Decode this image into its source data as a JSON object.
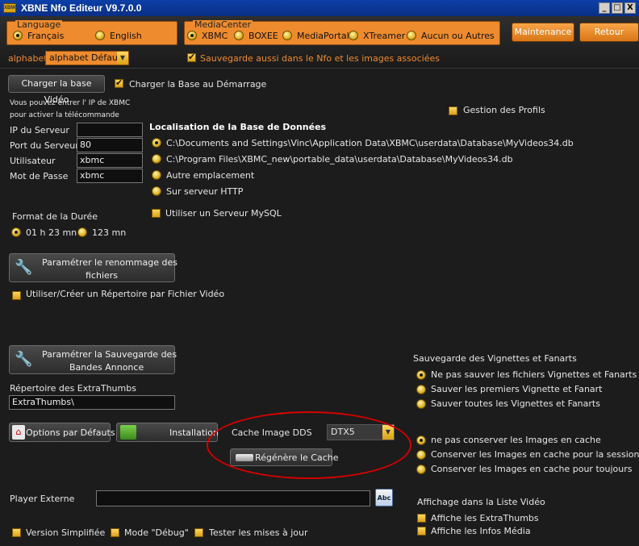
{
  "window": {
    "title": "XBNE Nfo Editeur V9.7.0.0",
    "app_icon_text": "XBMC",
    "min": "_",
    "max": "□",
    "close": "X"
  },
  "language": {
    "label": "Language",
    "options": [
      {
        "label": "Français",
        "selected": true
      },
      {
        "label": "English",
        "selected": false
      }
    ]
  },
  "mediacenter": {
    "label": "MediaCenter",
    "options": [
      {
        "label": "XBMC",
        "selected": true
      },
      {
        "label": "BOXEE",
        "selected": false
      },
      {
        "label": "MediaPortal",
        "selected": false
      },
      {
        "label": "XTreamer",
        "selected": false
      },
      {
        "label": "Aucun ou Autres",
        "selected": false
      }
    ]
  },
  "toolbar": {
    "maintenance": "Maintenance",
    "retour": "Retour"
  },
  "alphabet": {
    "label": "alphabet",
    "value": "alphabet Défaut"
  },
  "save_nfo": {
    "label": "Sauvegarde aussi dans le Nfo et les images associées",
    "checked": true
  },
  "db": {
    "load_button": "Charger la base Vidéo",
    "load_on_start": {
      "label": "Charger la Base au Démarrage",
      "checked": true
    },
    "remote_note_1": "Vous pouvez entrer l' IP de XBMC",
    "remote_note_2": "pour activer la télécommande",
    "profiles": "Gestion des Profils",
    "fields": {
      "ip_label": "IP du Serveur",
      "ip_value": "",
      "port_label": "Port du Serveur",
      "port_value": "80",
      "user_label": "Utilisateur",
      "user_value": "xbmc",
      "pass_label": "Mot de Passe",
      "pass_value": "xbmc"
    },
    "location_title": "Localisation de la Base de Données",
    "locations": [
      {
        "label": "C:\\Documents and Settings\\Vinc\\Application Data\\XBMC\\userdata\\Database\\MyVideos34.db",
        "selected": true
      },
      {
        "label": "C:\\Program Files\\XBMC_new\\portable_data\\userdata\\Database\\MyVideos34.db",
        "selected": false
      },
      {
        "label": "Autre emplacement",
        "selected": false
      },
      {
        "label": "Sur serveur HTTP",
        "selected": false
      }
    ],
    "mysql": "Utiliser un Serveur MySQL"
  },
  "duration": {
    "label": "Format de la Durée",
    "options": [
      {
        "label": "01 h 23 mn",
        "selected": true
      },
      {
        "label": "123 mn",
        "selected": false
      }
    ]
  },
  "rename": {
    "button_line1": "Paramétrer le renommage des",
    "button_line2": "fichiers",
    "per_file_dir": "Utiliser/Créer un Répertoire par Fichier Vidéo"
  },
  "trailers": {
    "button_line1": "Paramétrer la Sauvegarde des",
    "button_line2": "Bandes Annonce",
    "extrathumbs_label": "Répertoire des ExtraThumbs",
    "extrathumbs_value": "ExtraThumbs\\"
  },
  "thumbs": {
    "title": "Sauvegarde des Vignettes et Fanarts",
    "options": [
      {
        "label": "Ne pas sauver les fichiers Vignettes et Fanarts",
        "selected": true
      },
      {
        "label": "Sauver les premiers Vignette et Fanart",
        "selected": false
      },
      {
        "label": "Sauver toutes les Vignettes et Fanarts",
        "selected": false
      }
    ]
  },
  "actions": {
    "defaults": "Options par Défauts",
    "install": "Installation"
  },
  "cache": {
    "label": "Cache Image DDS",
    "value": "DTX5",
    "regen": "Régénère le Cache",
    "options": [
      {
        "label": "ne pas conserver les Images en cache",
        "selected": true
      },
      {
        "label": "Conserver les Images en cache pour la session",
        "selected": false
      },
      {
        "label": "Conserver les Images en cache pour toujours",
        "selected": false
      }
    ]
  },
  "player": {
    "label": "Player Externe",
    "value": "",
    "browse_icon_text": "Abc"
  },
  "list": {
    "title": "Affichage dans la Liste Vidéo",
    "extrathumbs": "Affiche les ExtraThumbs",
    "infos": "Affiche les Infos Média"
  },
  "footer": {
    "simple": "Version Simplifiée",
    "debug": "Mode \"Débug\"",
    "updates": "Tester les mises à jour"
  },
  "colors": {
    "accent": "#ee8b2e",
    "background": "#1c1c1c",
    "titlebar": "#0a2f84",
    "highlight": "#d40000"
  }
}
